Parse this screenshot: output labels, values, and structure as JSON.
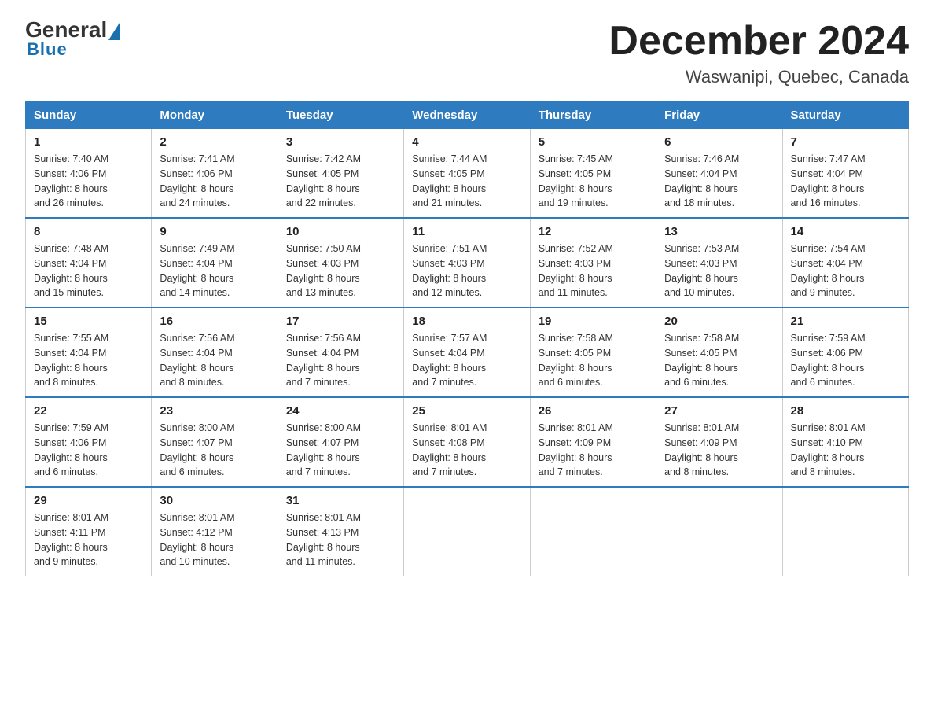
{
  "logo": {
    "general": "General",
    "blue": "Blue"
  },
  "title": "December 2024",
  "subtitle": "Waswanipi, Quebec, Canada",
  "days_of_week": [
    "Sunday",
    "Monday",
    "Tuesday",
    "Wednesday",
    "Thursday",
    "Friday",
    "Saturday"
  ],
  "weeks": [
    [
      {
        "day": "1",
        "sunrise": "7:40 AM",
        "sunset": "4:06 PM",
        "daylight": "8 hours and 26 minutes."
      },
      {
        "day": "2",
        "sunrise": "7:41 AM",
        "sunset": "4:06 PM",
        "daylight": "8 hours and 24 minutes."
      },
      {
        "day": "3",
        "sunrise": "7:42 AM",
        "sunset": "4:05 PM",
        "daylight": "8 hours and 22 minutes."
      },
      {
        "day": "4",
        "sunrise": "7:44 AM",
        "sunset": "4:05 PM",
        "daylight": "8 hours and 21 minutes."
      },
      {
        "day": "5",
        "sunrise": "7:45 AM",
        "sunset": "4:05 PM",
        "daylight": "8 hours and 19 minutes."
      },
      {
        "day": "6",
        "sunrise": "7:46 AM",
        "sunset": "4:04 PM",
        "daylight": "8 hours and 18 minutes."
      },
      {
        "day": "7",
        "sunrise": "7:47 AM",
        "sunset": "4:04 PM",
        "daylight": "8 hours and 16 minutes."
      }
    ],
    [
      {
        "day": "8",
        "sunrise": "7:48 AM",
        "sunset": "4:04 PM",
        "daylight": "8 hours and 15 minutes."
      },
      {
        "day": "9",
        "sunrise": "7:49 AM",
        "sunset": "4:04 PM",
        "daylight": "8 hours and 14 minutes."
      },
      {
        "day": "10",
        "sunrise": "7:50 AM",
        "sunset": "4:03 PM",
        "daylight": "8 hours and 13 minutes."
      },
      {
        "day": "11",
        "sunrise": "7:51 AM",
        "sunset": "4:03 PM",
        "daylight": "8 hours and 12 minutes."
      },
      {
        "day": "12",
        "sunrise": "7:52 AM",
        "sunset": "4:03 PM",
        "daylight": "8 hours and 11 minutes."
      },
      {
        "day": "13",
        "sunrise": "7:53 AM",
        "sunset": "4:03 PM",
        "daylight": "8 hours and 10 minutes."
      },
      {
        "day": "14",
        "sunrise": "7:54 AM",
        "sunset": "4:04 PM",
        "daylight": "8 hours and 9 minutes."
      }
    ],
    [
      {
        "day": "15",
        "sunrise": "7:55 AM",
        "sunset": "4:04 PM",
        "daylight": "8 hours and 8 minutes."
      },
      {
        "day": "16",
        "sunrise": "7:56 AM",
        "sunset": "4:04 PM",
        "daylight": "8 hours and 8 minutes."
      },
      {
        "day": "17",
        "sunrise": "7:56 AM",
        "sunset": "4:04 PM",
        "daylight": "8 hours and 7 minutes."
      },
      {
        "day": "18",
        "sunrise": "7:57 AM",
        "sunset": "4:04 PM",
        "daylight": "8 hours and 7 minutes."
      },
      {
        "day": "19",
        "sunrise": "7:58 AM",
        "sunset": "4:05 PM",
        "daylight": "8 hours and 6 minutes."
      },
      {
        "day": "20",
        "sunrise": "7:58 AM",
        "sunset": "4:05 PM",
        "daylight": "8 hours and 6 minutes."
      },
      {
        "day": "21",
        "sunrise": "7:59 AM",
        "sunset": "4:06 PM",
        "daylight": "8 hours and 6 minutes."
      }
    ],
    [
      {
        "day": "22",
        "sunrise": "7:59 AM",
        "sunset": "4:06 PM",
        "daylight": "8 hours and 6 minutes."
      },
      {
        "day": "23",
        "sunrise": "8:00 AM",
        "sunset": "4:07 PM",
        "daylight": "8 hours and 6 minutes."
      },
      {
        "day": "24",
        "sunrise": "8:00 AM",
        "sunset": "4:07 PM",
        "daylight": "8 hours and 7 minutes."
      },
      {
        "day": "25",
        "sunrise": "8:01 AM",
        "sunset": "4:08 PM",
        "daylight": "8 hours and 7 minutes."
      },
      {
        "day": "26",
        "sunrise": "8:01 AM",
        "sunset": "4:09 PM",
        "daylight": "8 hours and 7 minutes."
      },
      {
        "day": "27",
        "sunrise": "8:01 AM",
        "sunset": "4:09 PM",
        "daylight": "8 hours and 8 minutes."
      },
      {
        "day": "28",
        "sunrise": "8:01 AM",
        "sunset": "4:10 PM",
        "daylight": "8 hours and 8 minutes."
      }
    ],
    [
      {
        "day": "29",
        "sunrise": "8:01 AM",
        "sunset": "4:11 PM",
        "daylight": "8 hours and 9 minutes."
      },
      {
        "day": "30",
        "sunrise": "8:01 AM",
        "sunset": "4:12 PM",
        "daylight": "8 hours and 10 minutes."
      },
      {
        "day": "31",
        "sunrise": "8:01 AM",
        "sunset": "4:13 PM",
        "daylight": "8 hours and 11 minutes."
      },
      null,
      null,
      null,
      null
    ]
  ]
}
